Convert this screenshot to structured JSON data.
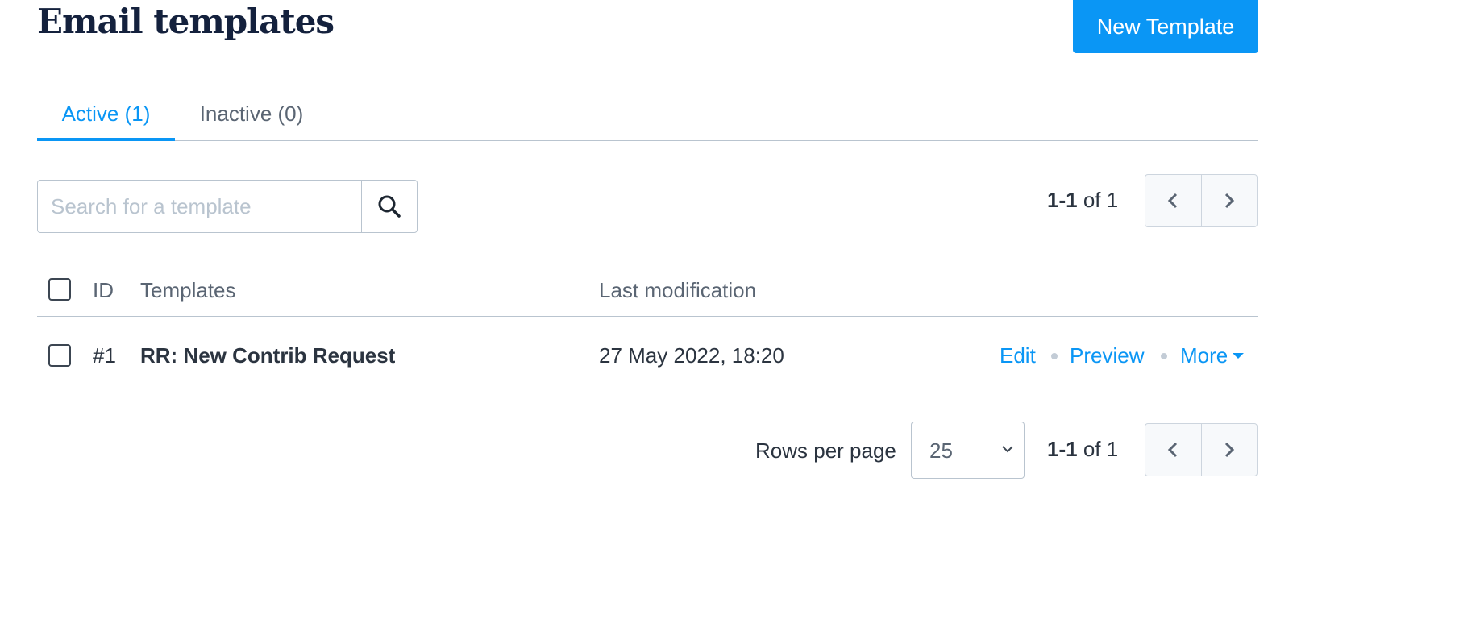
{
  "header": {
    "title": "Email templates",
    "new_button_label": "New Template"
  },
  "tabs": [
    {
      "label": "Active (1)",
      "active": true
    },
    {
      "label": "Inactive (0)",
      "active": false
    }
  ],
  "search": {
    "placeholder": "Search for a template",
    "value": ""
  },
  "pagination_top": {
    "range_start": "1",
    "range_end": "1",
    "of_label": "of 1"
  },
  "table": {
    "columns": [
      "ID",
      "Templates",
      "Last modification"
    ],
    "rows": [
      {
        "id": "#1",
        "name": "RR: New Contrib Request",
        "last_modification": "27 May 2022, 18:20",
        "actions": [
          "Edit",
          "Preview",
          "More"
        ]
      }
    ]
  },
  "footer": {
    "rows_per_page_label": "Rows per page",
    "rows_per_page_value": "25",
    "range_start": "1",
    "range_end": "1",
    "of_label": "of 1"
  },
  "colors": {
    "accent": "#0a96f5",
    "title": "#14213d",
    "text": "#2b3440",
    "muted": "#5a6573",
    "border": "#b9c4cf"
  },
  "icons": {
    "search": "search-icon",
    "prev": "chevron-left-icon",
    "next": "chevron-right-icon",
    "dropdown": "chevron-down-icon",
    "more_caret": "caret-down-icon"
  }
}
